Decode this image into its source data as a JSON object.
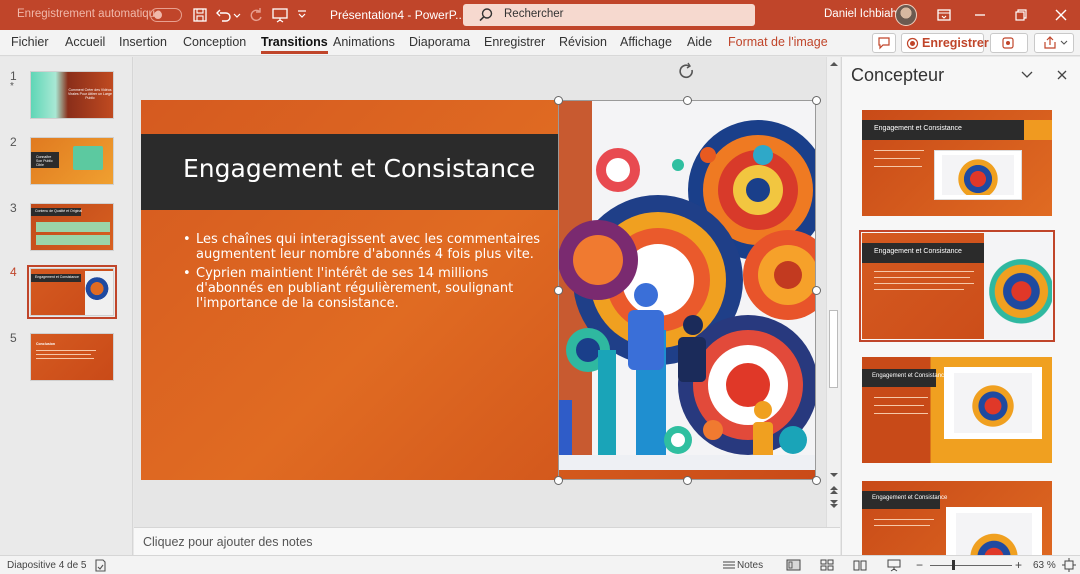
{
  "titlebar": {
    "autosave_label": "Enregistrement automatique",
    "doc_title": "Présentation4  -  PowerP...",
    "search_label": "Rechercher",
    "user_name": "Daniel Ichbiah"
  },
  "ribbon": {
    "tabs": [
      "Fichier",
      "Accueil",
      "Insertion",
      "Conception",
      "Transitions",
      "Animations",
      "Diaporama",
      "Enregistrer",
      "Révision",
      "Affichage",
      "Aide",
      "Format de l'image"
    ],
    "active_tab": "Transitions",
    "save_button": "Enregistrer"
  },
  "thumbnails": [
    {
      "number": "1",
      "marker": "*",
      "text": "Comment Créer des Vidéos Virales Pour Attirer un Large Public"
    },
    {
      "number": "2",
      "text": "Connaître Son Public Cible"
    },
    {
      "number": "3",
      "text": "Contenu de Qualité et Original"
    },
    {
      "number": "4",
      "text": "Engagement et Consistance"
    },
    {
      "number": "5",
      "text": "Conclusion"
    }
  ],
  "slide": {
    "title": "Engagement et Consistance",
    "bullets": [
      "Les chaînes qui interagissent avec les commentaires augmentent leur nombre d'abonnés 4 fois plus vite.",
      "Cyprien maintient l'intérêt de ses 14 millions d'abonnés en publiant régulièrement, soulignant l'importance de la consistance."
    ]
  },
  "notes_placeholder": "Cliquez pour ajouter des notes",
  "designer": {
    "title": "Concepteur",
    "card_title": "Engagement et Consistance"
  },
  "status": {
    "slide_counter": "Diapositive 4 de 5",
    "notes_label": "Notes",
    "zoom": "63 %"
  },
  "colors": {
    "accent": "#c0452a",
    "slide_orange": "#e06b22",
    "title_band": "#2b2b2b"
  }
}
